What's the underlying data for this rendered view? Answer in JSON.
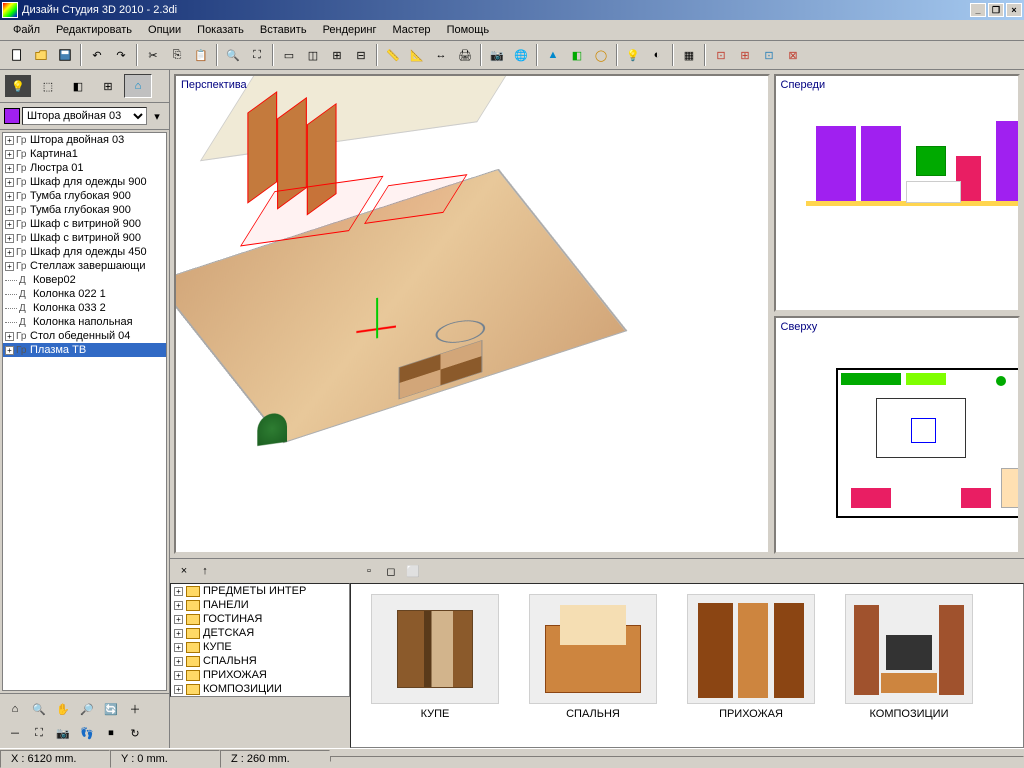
{
  "window": {
    "title": "Дизайн Студия 3D 2010 - 2.3di"
  },
  "menu": [
    "Файл",
    "Редактировать",
    "Опции",
    "Показать",
    "Вставить",
    "Рендеринг",
    "Мастер",
    "Помощь"
  ],
  "selector": {
    "value": "Штора двойная 03"
  },
  "scene_tree": [
    {
      "exp": "+",
      "type": "Гр",
      "label": "Штора двойная 03"
    },
    {
      "exp": "+",
      "type": "Гр",
      "label": "Картина1"
    },
    {
      "exp": "+",
      "type": "Гр",
      "label": "Люстра 01"
    },
    {
      "exp": "+",
      "type": "Гр",
      "label": "Шкаф для одежды 900"
    },
    {
      "exp": "+",
      "type": "Гр",
      "label": "Тумба глубокая 900"
    },
    {
      "exp": "+",
      "type": "Гр",
      "label": "Тумба глубокая 900"
    },
    {
      "exp": "+",
      "type": "Гр",
      "label": "Шкаф с витриной 900"
    },
    {
      "exp": "+",
      "type": "Гр",
      "label": "Шкаф с витриной 900"
    },
    {
      "exp": "+",
      "type": "Гр",
      "label": "Шкаф для одежды 450"
    },
    {
      "exp": "+",
      "type": "Гр",
      "label": "Стеллаж завершающи"
    },
    {
      "exp": "",
      "type": "Д",
      "label": "Ковер02"
    },
    {
      "exp": "",
      "type": "Д",
      "label": "Колонка 022 1"
    },
    {
      "exp": "",
      "type": "Д",
      "label": "Колонка 033 2"
    },
    {
      "exp": "",
      "type": "Д",
      "label": "Колонка напольная"
    },
    {
      "exp": "+",
      "type": "Гр",
      "label": "Стол обеденный 04"
    },
    {
      "exp": "+",
      "type": "Гр",
      "label": "Плазма ТВ",
      "selected": true
    }
  ],
  "viewports": {
    "persp": "Перспектива",
    "front": "Спереди",
    "top": "Сверху"
  },
  "catalog": [
    "ПРЕДМЕТЫ ИНТЕР",
    "ПАНЕЛИ",
    "ГОСТИНАЯ",
    "ДЕТСКАЯ",
    "КУПЕ",
    "СПАЛЬНЯ",
    "ПРИХОЖАЯ",
    "КОМПОЗИЦИИ"
  ],
  "thumbs": [
    "КУПЕ",
    "СПАЛЬНЯ",
    "ПРИХОЖАЯ",
    "КОМПОЗИЦИИ"
  ],
  "status": {
    "x": "X : 6120 mm.",
    "y": "Y : 0 mm.",
    "z": "Z : 260 mm."
  }
}
